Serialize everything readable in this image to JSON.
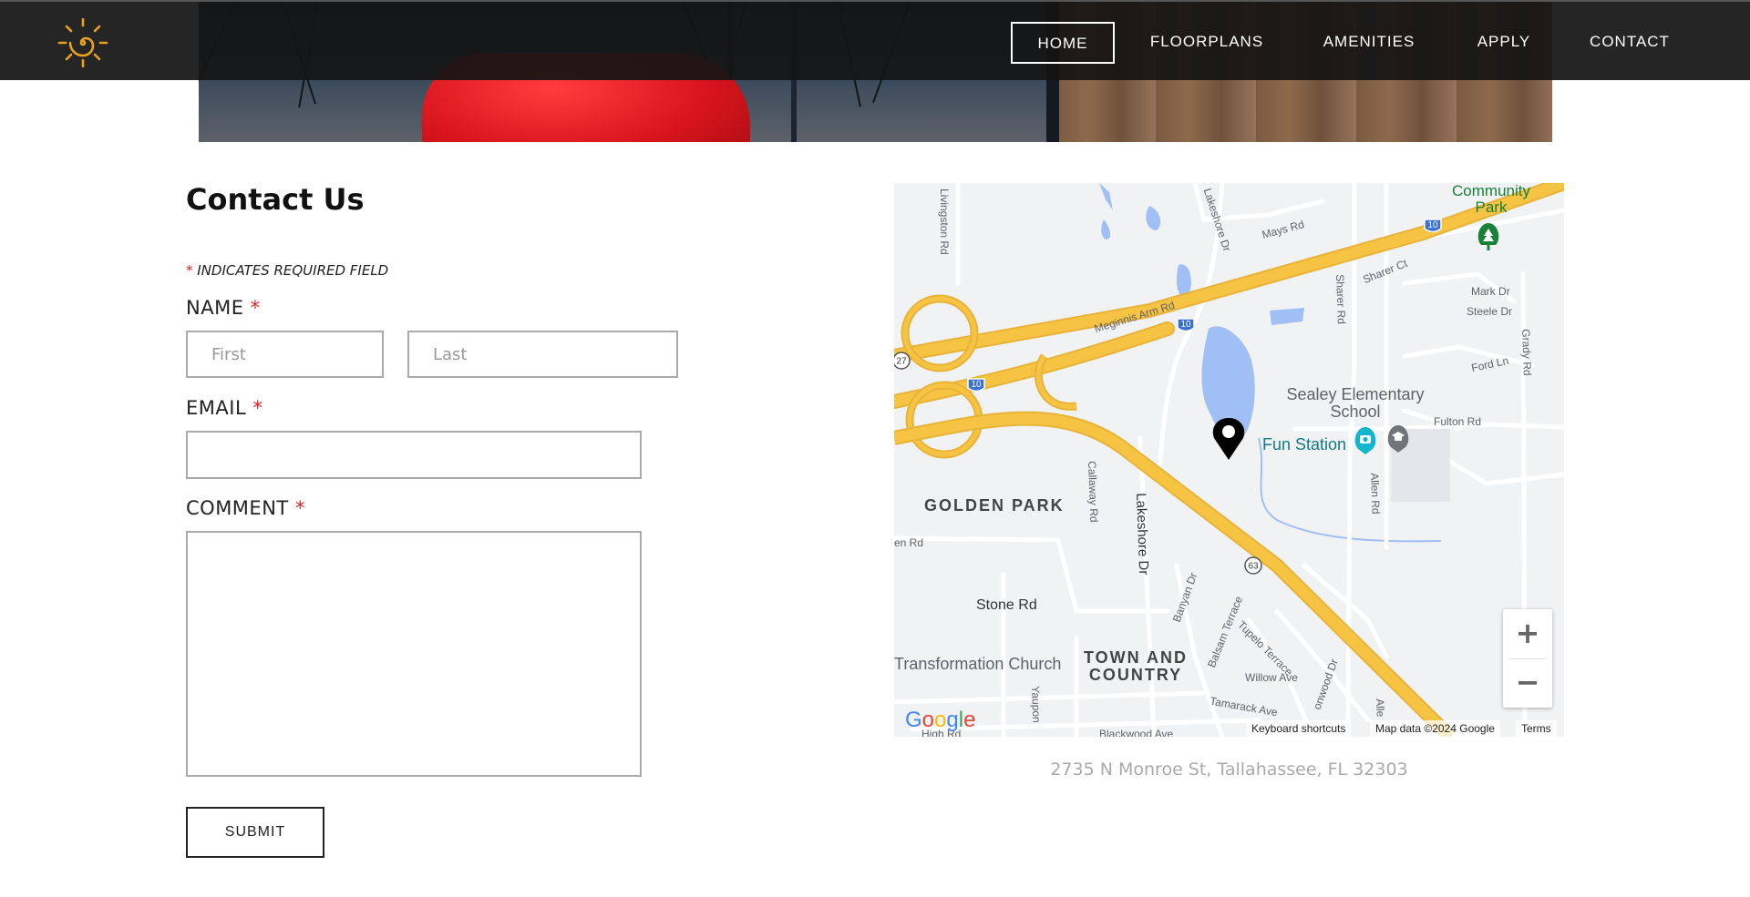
{
  "nav": {
    "items": [
      {
        "label": "HOME",
        "active": true
      },
      {
        "label": "FLOORPLANS",
        "active": false
      },
      {
        "label": "AMENITIES",
        "active": false
      },
      {
        "label": "APPLY",
        "active": false
      },
      {
        "label": "CONTACT",
        "active": false
      }
    ]
  },
  "logo": {
    "icon": "sun-spiral-icon",
    "color": "#e8a317"
  },
  "form": {
    "title": "Contact Us",
    "required_note": "INDICATES REQUIRED FIELD",
    "required_mark": "*",
    "name_label": "NAME",
    "first_placeholder": "First",
    "last_placeholder": "Last",
    "email_label": "EMAIL",
    "comment_label": "COMMENT",
    "submit_label": "SUBMIT"
  },
  "map": {
    "roads": [
      "Livingston Rd",
      "Lakeshore Dr",
      "Mays Rd",
      "Meginnis Arm Rd",
      "Sharer Rd",
      "Sharer Ct",
      "Mark Dr",
      "Steele Dr",
      "Grady Rd",
      "Ford Ln",
      "Fulton Rd",
      "Allen Rd",
      "Callaway Rd",
      "Lakeshore Dr",
      "Stone Rd",
      "Banyan Dr",
      "Balsam Terrace",
      "Tupelo Terrace",
      "Willow Ave",
      "Tamarack Ave",
      "Blackwood Ave",
      "Yaupon",
      "en Rd",
      "High Rd",
      "onwood Dr",
      "Alle"
    ],
    "highway_shields": [
      "10",
      "10",
      "10",
      "27",
      "63"
    ],
    "areas": [
      "GOLDEN PARK",
      "TOWN AND COUNTRY"
    ],
    "pois": {
      "community_park": "Community Park",
      "school": "Sealey Elementary School",
      "fun_station": "Fun Station",
      "church": "Transformation Church"
    },
    "zoom_in": "+",
    "zoom_out": "−",
    "google": "Google",
    "shortcuts": "Keyboard shortcuts",
    "map_data": "Map data ©2024 Google",
    "terms": "Terms"
  },
  "address": "2735 N Monroe St, Tallahassee, FL 32303",
  "colors": {
    "nav_bg": "#141414",
    "highway": "#f6c342",
    "water": "#9fbff5",
    "pin": "#000000",
    "teal": "#137b85",
    "required_star": "#e02020"
  }
}
